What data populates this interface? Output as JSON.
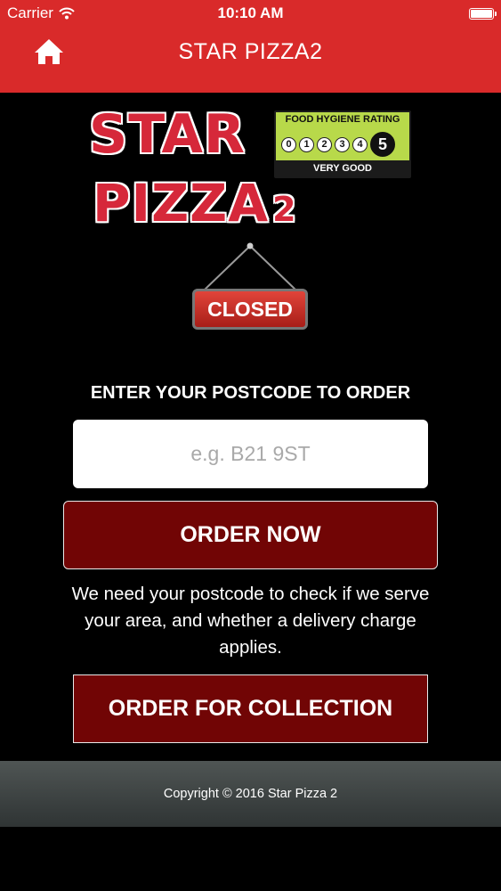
{
  "status_bar": {
    "carrier": "Carrier",
    "time": "10:10 AM",
    "wifi_icon": "wifi-icon",
    "battery_icon": "battery-icon"
  },
  "nav": {
    "title": "STAR PIZZA2",
    "home_icon": "home-icon"
  },
  "logo": {
    "line1": "STAR",
    "line2": "PIZZA",
    "line2_suffix": "2"
  },
  "hygiene_rating": {
    "heading": "FOOD HYGIENE RATING",
    "scores": [
      "0",
      "1",
      "2",
      "3",
      "4",
      "5"
    ],
    "selected": "5",
    "label": "VERY GOOD"
  },
  "status_sign": {
    "text": "CLOSED"
  },
  "order_form": {
    "heading": "ENTER YOUR POSTCODE TO ORDER",
    "postcode_value": "",
    "postcode_placeholder": "e.g. B21 9ST",
    "order_now_label": "ORDER NOW",
    "note": "We need your postcode to check if we serve your area, and whether a delivery charge applies.",
    "collection_label": "ORDER FOR COLLECTION"
  },
  "footer": {
    "copyright": "Copyright © 2016 Star Pizza 2"
  },
  "colors": {
    "header": "#d92a2a",
    "button": "#710505",
    "logo_red": "#d6283a",
    "rating_green": "#b8d94a",
    "background": "#000000"
  }
}
